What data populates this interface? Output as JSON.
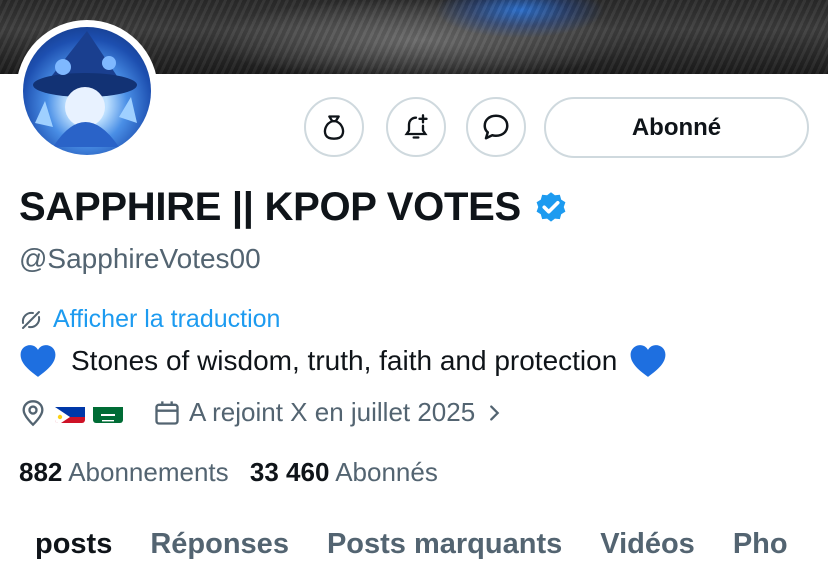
{
  "profile": {
    "display_name": "SAPPHIRE || KPOP VOTES",
    "handle": "@SapphireVotes00",
    "translate_label": "Afficher la traduction",
    "bio_text": "Stones of wisdom, truth, faith and protection",
    "join_date": "A rejoint X en juillet 2025",
    "following_count": "882",
    "following_label": "Abonnements",
    "followers_count": "33 460",
    "followers_label": "Abonnés"
  },
  "actions": {
    "follow_label": "Abonné"
  },
  "tabs": [
    {
      "label": "posts"
    },
    {
      "label": "Réponses"
    },
    {
      "label": "Posts marquants"
    },
    {
      "label": "Vidéos"
    },
    {
      "label": "Pho"
    }
  ],
  "colors": {
    "accent": "#1d9bf0",
    "text": "#0f1419",
    "secondary": "#536471",
    "border": "#cfd9de"
  },
  "icons": [
    "money-bag-icon",
    "bell-plus-icon",
    "message-icon",
    "verified-badge-icon",
    "translate-icon",
    "location-icon",
    "calendar-icon",
    "chevron-right-icon",
    "blue-heart-icon"
  ]
}
